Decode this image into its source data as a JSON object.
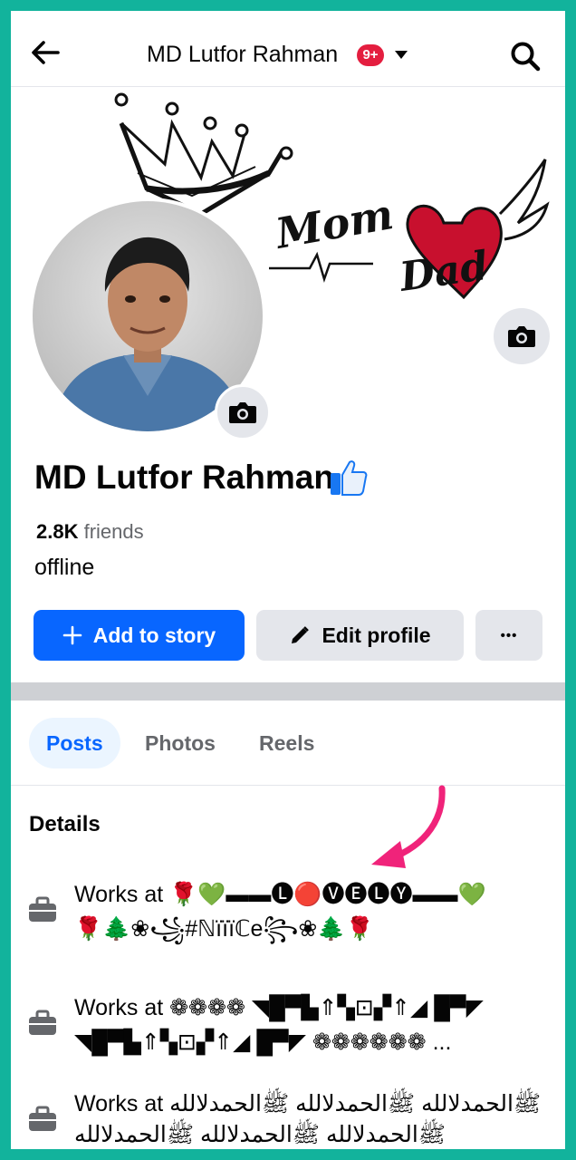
{
  "header": {
    "title": "MD Lutfor Rahman",
    "badge": "9+"
  },
  "cover": {
    "text_art": "Mom Dad"
  },
  "profile": {
    "name": "MD Lutfor Rahman",
    "friends_count": "2.8K",
    "friends_label": "friends",
    "status": "offline"
  },
  "actions": {
    "add_story": "Add to story",
    "edit_profile": "Edit profile",
    "more": "•••"
  },
  "tabs": [
    {
      "label": "Posts",
      "active": true
    },
    {
      "label": "Photos",
      "active": false
    },
    {
      "label": "Reels",
      "active": false
    }
  ],
  "details": {
    "title": "Details",
    "items": [
      {
        "line1": "Works at 🌹💚▬▬🅛🔴🅥🅔🅛🅨▬▬💚",
        "line2": "🌹🌲❀꧁#ℕïïïℂe꧂❀🌲🌹"
      },
      {
        "line1": "Works at ❁❁❁❁ ◥█▀▙⇑▚⊡▞⇑◢ █▀◤",
        "line2": "◥█▀▙⇑▚⊡▞⇑◢ █▀◤ ❁❁❁❁❁❁ ..."
      },
      {
        "line1": "Works at ﷺالحمدلالله ﷺالحمدلالله ﷺالحمدلالله",
        "line2": "ﷺالحمدلالله ﷺالحمدلالله ﷺالحمدلالله"
      }
    ]
  },
  "colors": {
    "accent": "#0866ff",
    "frame": "#12b39c",
    "badge": "#e41e3f",
    "arrow": "#f0237a"
  }
}
